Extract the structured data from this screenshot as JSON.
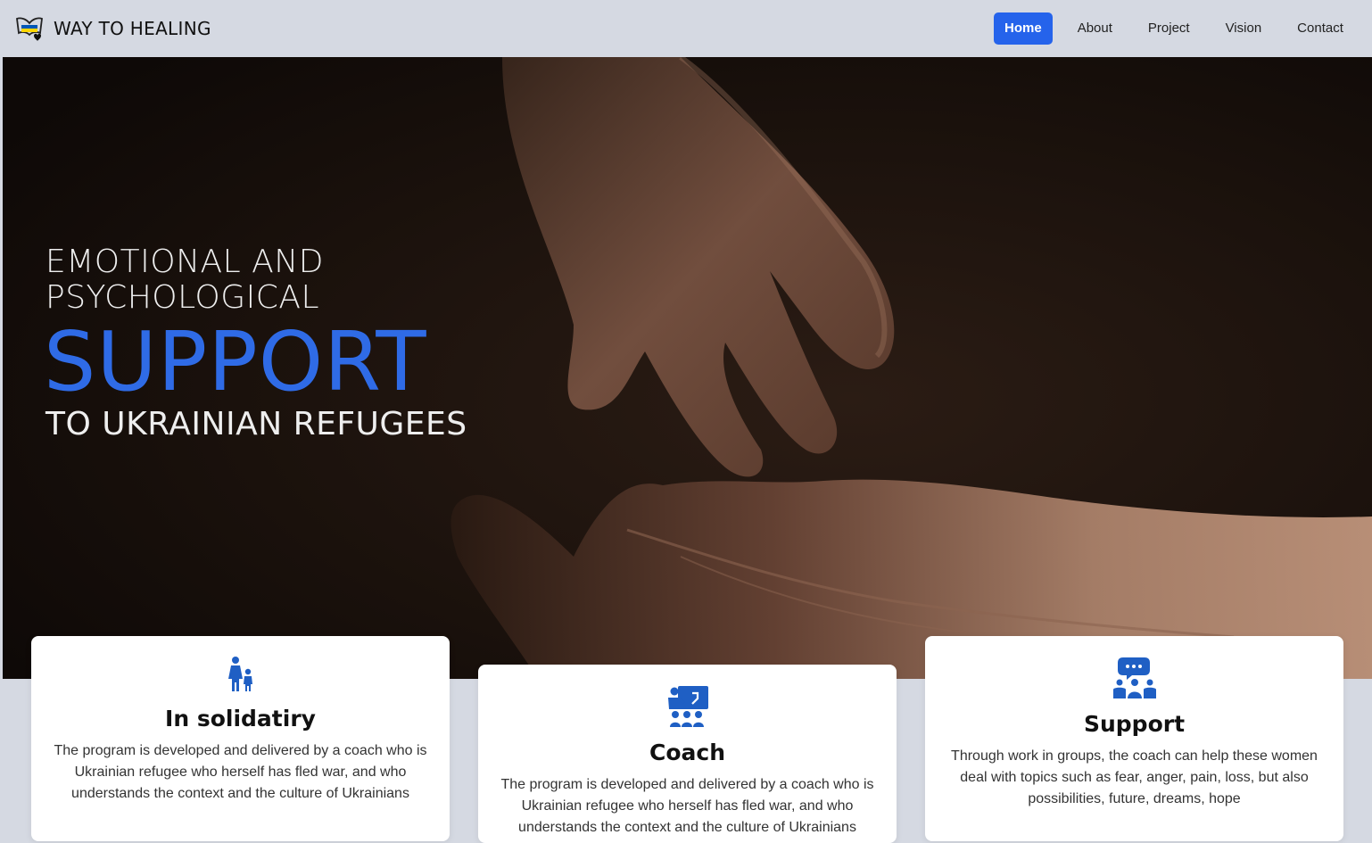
{
  "brand": {
    "name": "WAY TO HEALING",
    "logo_icon": "heart-butterfly-logo-icon",
    "flag_colors": [
      "#0057b7",
      "#ffd700"
    ]
  },
  "nav": {
    "items": [
      {
        "label": "Home",
        "active": true
      },
      {
        "label": "About"
      },
      {
        "label": "Project"
      },
      {
        "label": "Vision"
      },
      {
        "label": "Contact"
      }
    ]
  },
  "hero": {
    "line1": "EMOTIONAL AND",
    "line2": "PSYCHOLOGICAL",
    "highlight": "SUPPORT",
    "line4": "TO UKRAINIAN REFUGEES",
    "highlight_color": "#2f6be6",
    "background_icon": "reaching-hands-photo"
  },
  "cards": [
    {
      "icon": "mother-child-icon",
      "title": "In solidatiry",
      "text": "The program is developed and delivered by a coach who is Ukrainian refugee who herself has fled war, and who understands the context and the culture of Ukrainians"
    },
    {
      "icon": "coach-teaching-icon",
      "title": "Coach",
      "text": "The program is developed and delivered by a coach who is Ukrainian refugee who herself has fled war, and who understands the context and the culture of Ukrainians"
    },
    {
      "icon": "group-discussion-icon",
      "title": "Support",
      "text": "Through work in groups, the coach can help these women deal with topics such as fear, anger, pain, loss, but also possibilities, future, dreams, hope"
    }
  ],
  "colors": {
    "accent": "#2563eb",
    "icon_blue": "#1f5fc4",
    "nav_bg": "#d5d9e2"
  }
}
